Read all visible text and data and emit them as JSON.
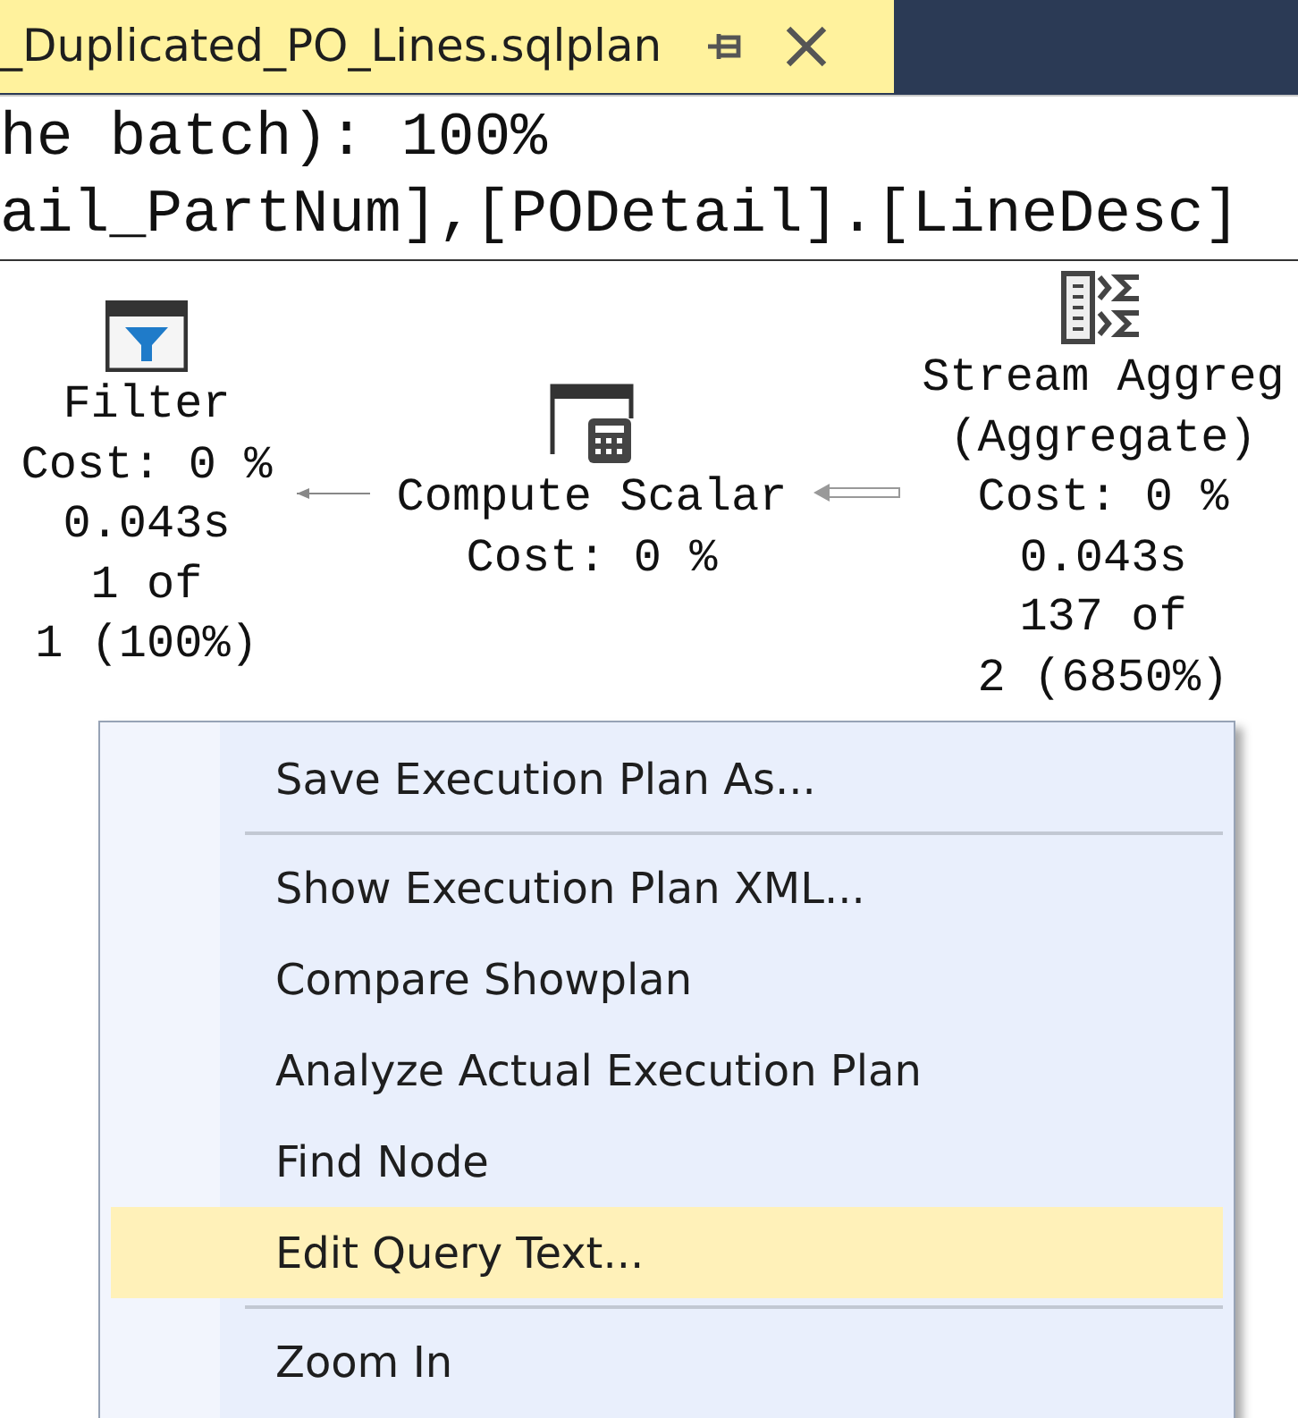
{
  "tab": {
    "title": "_Duplicated_PO_Lines.sqlplan",
    "selected": true
  },
  "header_lines": [
    "he batch): 100%",
    "ail_PartNum],[PODetail].[LineDesc]"
  ],
  "plan": {
    "nodes": [
      {
        "kind": "filter",
        "lines": [
          "Filter",
          "Cost: 0 %",
          "0.043s",
          "1 of",
          "1 (100%)"
        ]
      },
      {
        "kind": "compute",
        "lines": [
          "Compute Scalar",
          "Cost: 0 %"
        ]
      },
      {
        "kind": "aggregate",
        "lines": [
          "Stream Aggreg",
          "(Aggregate)",
          "Cost: 0 %",
          "0.043s",
          "137 of",
          "2 (6850%)"
        ]
      }
    ]
  },
  "context_menu": {
    "items": [
      {
        "kind": "item",
        "label": "Save Execution Plan As...",
        "selected": false
      },
      {
        "kind": "separator"
      },
      {
        "kind": "item",
        "label": "Show Execution Plan XML...",
        "selected": false
      },
      {
        "kind": "item",
        "label": "Compare Showplan",
        "selected": false
      },
      {
        "kind": "item",
        "label": "Analyze Actual Execution Plan",
        "selected": false
      },
      {
        "kind": "item",
        "label": "Find Node",
        "selected": false
      },
      {
        "kind": "item",
        "label": "Edit Query Text...",
        "selected": true
      },
      {
        "kind": "separator"
      },
      {
        "kind": "item",
        "label": "Zoom In",
        "selected": false
      }
    ]
  }
}
